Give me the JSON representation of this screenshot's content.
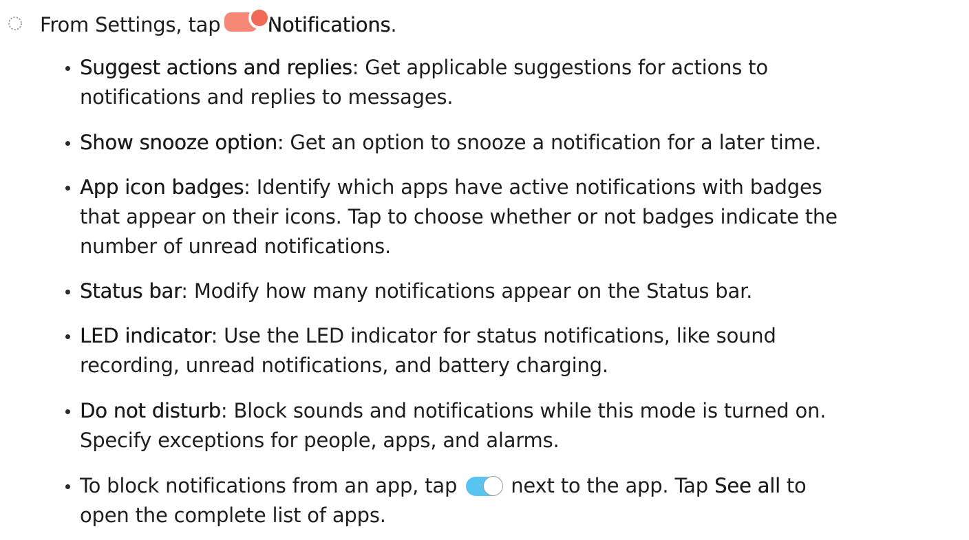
{
  "step": {
    "prefix": "From Settings, tap",
    "menu": "Notifications",
    "suffix": ".",
    "icon": "settings-notifications-icon",
    "icon_colors": {
      "tile": "#f58877",
      "dot": "#f06a57"
    }
  },
  "items": [
    {
      "term": "Suggest actions and replies",
      "line1": ": Get applicable suggestions for actions to",
      "line2": "notifications and replies to messages."
    },
    {
      "term": "Show snooze option",
      "line1": ": Get an option to snooze a notification for a later time."
    },
    {
      "term": "App icon badges",
      "line1": ": Identify which apps have active notifications with badges",
      "line2": "that appear on their icons. Tap to choose whether or not badges indicate the",
      "line3": "number of unread notifications."
    },
    {
      "term": "Status bar",
      "line1": ": Modify how many notifications appear on the Status bar."
    },
    {
      "term": "LED indicator",
      "line1": ": Use the LED indicator for status notifications, like sound",
      "line2": "recording, unread notifications, and battery charging."
    },
    {
      "term": "Do not disturb",
      "line1": ": Block sounds and notifications while this mode is turned on.",
      "line2": "Specify exceptions for people, apps, and alarms."
    },
    {
      "before": "To block notifications from an app, tap",
      "after": "next to the app. Tap",
      "term": "See all",
      "end": "to",
      "line2": "open the complete list of apps.",
      "toggle": {
        "icon": "toggle-switch-icon",
        "state": "on",
        "color": "#58c4f0"
      }
    }
  ]
}
